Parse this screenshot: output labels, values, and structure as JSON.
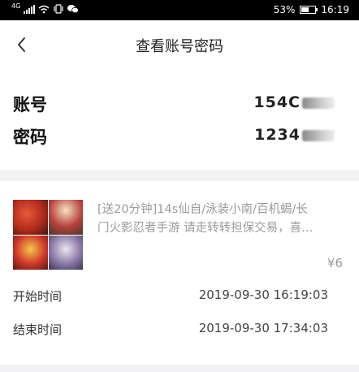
{
  "status_bar": {
    "network": "4G",
    "battery_percent": "53%",
    "battery_level": 0.53,
    "time": "16:19"
  },
  "header": {
    "title": "查看账号密码",
    "back_icon": "chevron-left-icon"
  },
  "account": {
    "account_label": "账号",
    "account_value": "154C",
    "password_label": "密码",
    "password_value": "1234"
  },
  "order": {
    "description_line1": "[送20分钟]14s仙自/泳装小南/百机蝎/长",
    "description_line2": "门火影忍者手游 请走转转担保交易，喜…",
    "price": "¥6",
    "start_label": "开始时间",
    "start_value": "2019-09-30 16:19:03",
    "end_label": "结束时间",
    "end_value": "2019-09-30 17:34:03"
  }
}
